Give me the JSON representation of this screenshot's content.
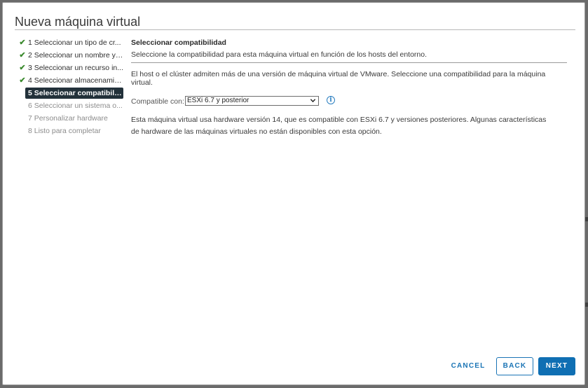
{
  "dialog": {
    "title": "Nueva máquina virtual"
  },
  "steps": [
    {
      "label": "1 Seleccionar un tipo de cr...",
      "state": "done",
      "icon": "check-icon"
    },
    {
      "label": "2 Seleccionar un nombre y ...",
      "state": "done",
      "icon": "check-icon"
    },
    {
      "label": "3 Seleccionar un recurso in...",
      "state": "done",
      "icon": "check-icon"
    },
    {
      "label": "4 Seleccionar almacenamie...",
      "state": "done",
      "icon": "check-icon"
    },
    {
      "label": "5 Seleccionar compatibilid...",
      "state": "active"
    },
    {
      "label": "6 Seleccionar un sistema o...",
      "state": "pending"
    },
    {
      "label": "7 Personalizar hardware",
      "state": "pending"
    },
    {
      "label": "8 Listo para completar",
      "state": "pending"
    }
  ],
  "content": {
    "section_title": "Seleccionar compatibilidad",
    "section_subtitle": "Seleccione la compatibilidad para esta máquina virtual en función de los hosts del entorno.",
    "description": "El host o el clúster admiten más de una versión de máquina virtual de VMware. Seleccione una compatibilidad para la máquina virtual.",
    "compat_label": "Compatible con:",
    "compat_value": "ESXi 6.7 y posterior",
    "note": "Esta máquina virtual usa hardware versión 14, que es compatible con ESXi 6.7 y versiones posteriores. Algunas características de hardware de las máquinas virtuales no están disponibles con esta opción."
  },
  "footer": {
    "cancel_label": "CANCEL",
    "back_label": "BACK",
    "next_label": "NEXT"
  },
  "colors": {
    "accent": "#0f6fb3",
    "active_step_bg": "#22313a",
    "check_green": "#3b8a2e"
  }
}
